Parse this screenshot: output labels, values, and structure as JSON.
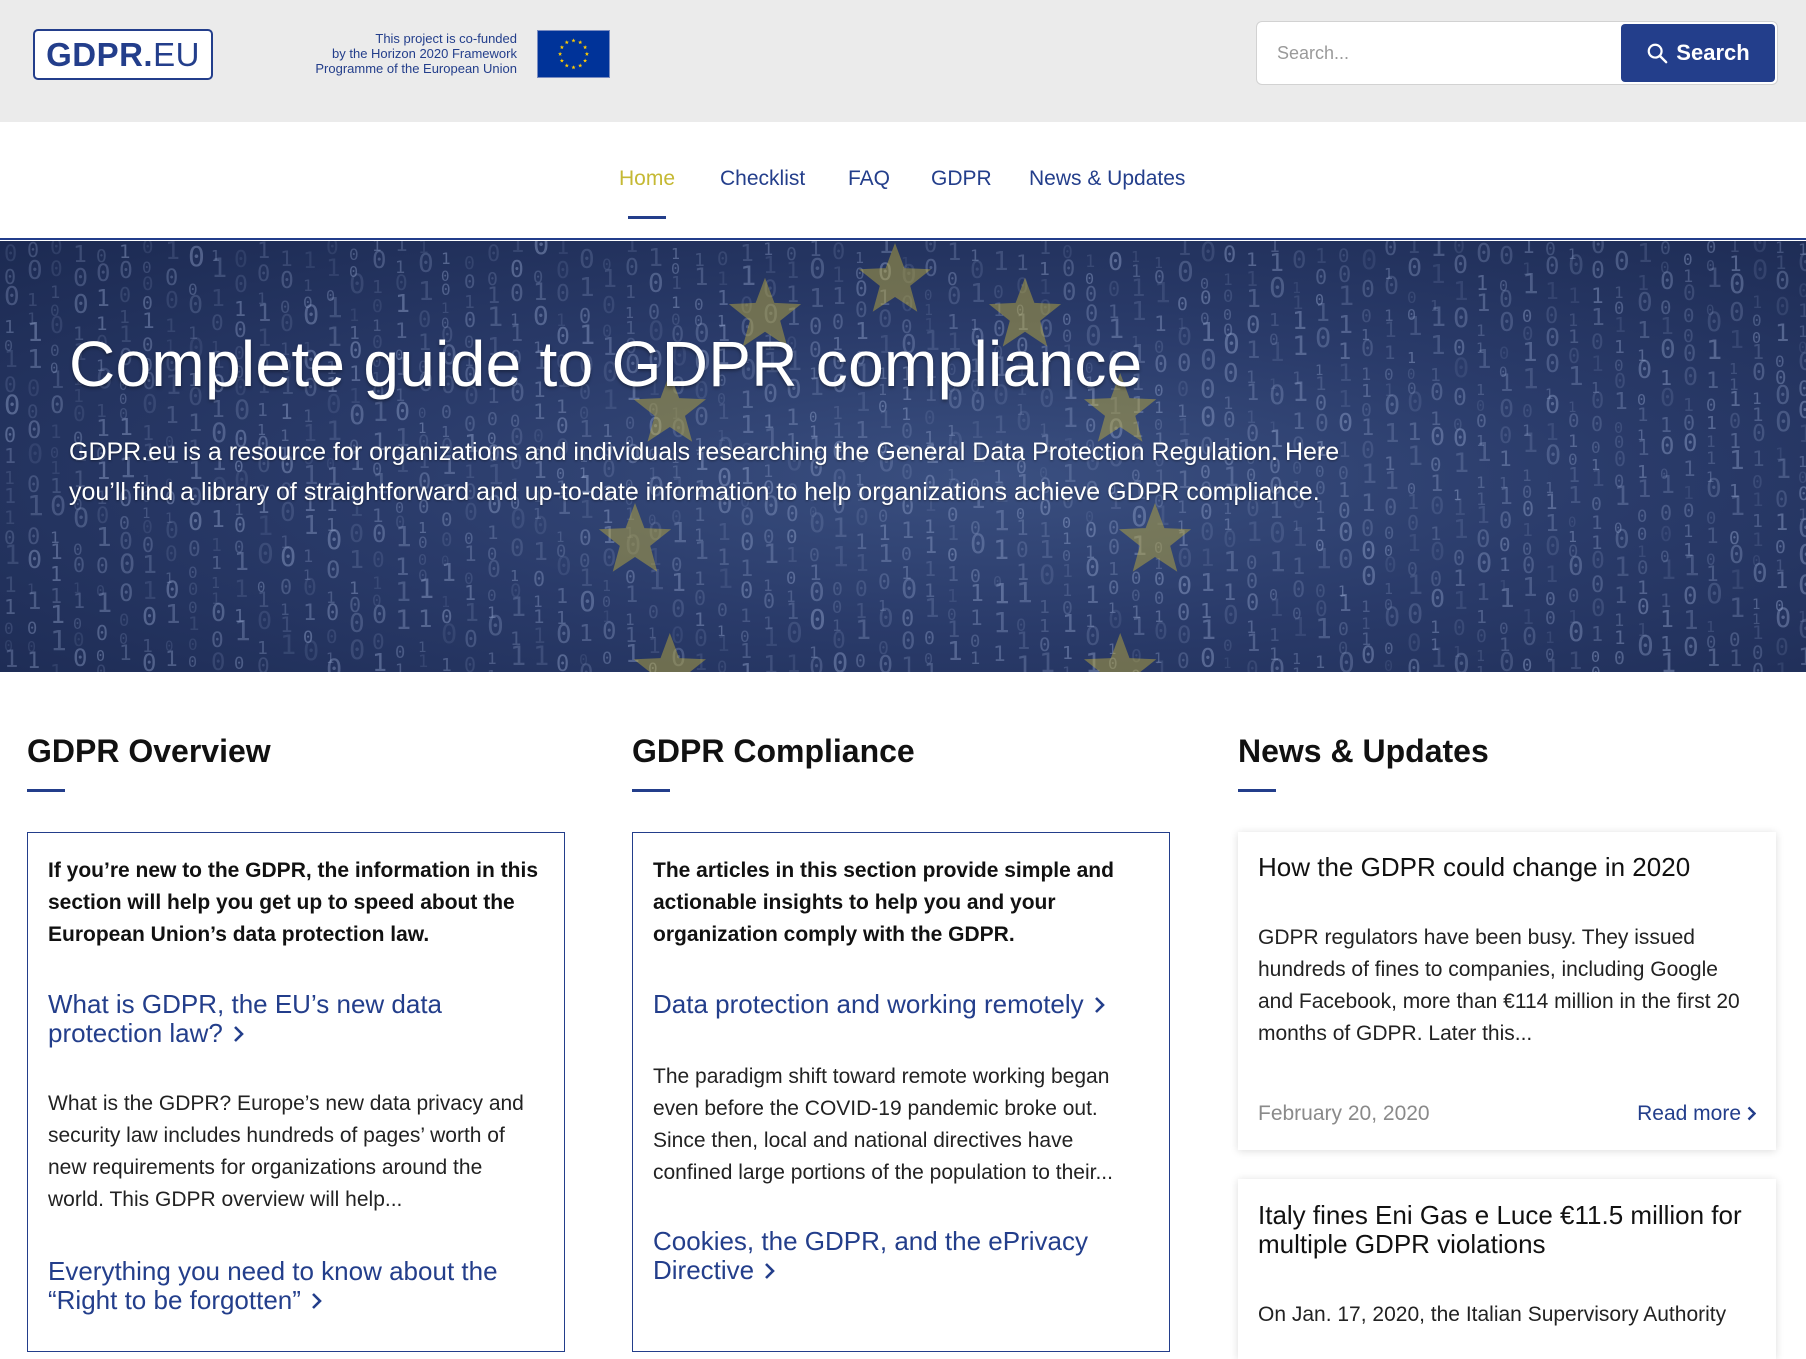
{
  "header": {
    "logo_bold": "GDPR.",
    "logo_light": "EU",
    "funded_lines": [
      "This project is co-funded",
      "by the Horizon 2020 Framework",
      "Programme of the European Union"
    ],
    "search_placeholder": "Search...",
    "search_button": "Search"
  },
  "nav": {
    "items": [
      "Home",
      "Checklist",
      "FAQ",
      "GDPR",
      "News & Updates"
    ],
    "active": "Home"
  },
  "hero": {
    "title": "Complete guide to GDPR compliance",
    "description": "GDPR.eu is a resource for organizations and individuals researching the General Data Protection Regulation. Here you’ll find a library of straightforward and up-to-date information to help organizations achieve GDPR compliance."
  },
  "overview": {
    "heading": "GDPR Overview",
    "intro": "If you’re new to the GDPR, the information in this section will help you get up to speed about the European Union’s data protection law.",
    "articles": [
      {
        "title": "What is GDPR, the EU’s new data protection law?",
        "excerpt": "What is the GDPR? Europe’s new data privacy and security law includes hundreds of pages’ worth of new requirements for organizations around the world. This GDPR overview will help..."
      },
      {
        "title": "Everything you need to know about the “Right to be forgotten”"
      }
    ]
  },
  "compliance": {
    "heading": "GDPR Compliance",
    "intro": "The articles in this section provide simple and actionable insights to help you and your organization comply with the GDPR.",
    "articles": [
      {
        "title": "Data protection and working remotely",
        "excerpt": "The paradigm shift toward remote working began even before the COVID-19 pandemic broke out. Since then, local and national directives have confined large portions of the population to their..."
      },
      {
        "title": "Cookies, the GDPR, and the ePrivacy Directive"
      }
    ]
  },
  "news": {
    "heading": "News & Updates",
    "items": [
      {
        "title": "How the GDPR could change in 2020",
        "excerpt": "GDPR regulators have been busy. They issued hundreds of fines to companies, including Google and Facebook, more than €114 million in the first 20 months of GDPR. Later this...",
        "date": "February 20, 2020",
        "read_more": "Read more"
      },
      {
        "title": "Italy fines Eni Gas e Luce €11.5 million for multiple GDPR violations",
        "excerpt": "On Jan. 17, 2020, the Italian Supervisory Authority"
      }
    ]
  },
  "colors": {
    "brand_blue": "#233e8b",
    "active_nav": "#c5b934",
    "top_bar": "#ebebeb",
    "hero_navy": "#2a3b6a"
  },
  "icons": [
    "search-icon",
    "eu-flag-icon",
    "chevron-right-icon"
  ]
}
